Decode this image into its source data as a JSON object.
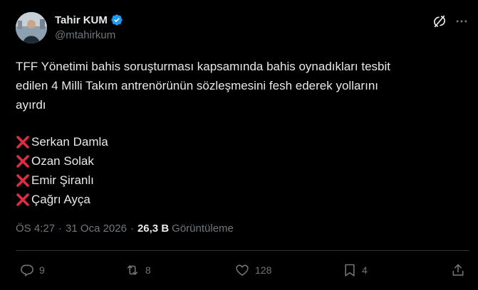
{
  "author": {
    "display_name": "Tahir KUM",
    "handle": "@mtahirkum",
    "verified_color": "#1d9bf0"
  },
  "header_icons": {
    "grok": "grok-icon",
    "more": "more-icon"
  },
  "tweet": {
    "lines": [
      "TFF Yönetimi bahis soruşturması kapsamında bahis oynadıkları tesbit",
      "edilen 4 Milli Takım antrenörünün sözleşmesini fesh ederek yollarını",
      "ayırdı"
    ],
    "list": [
      "Serkan Damla",
      "Ozan Solak",
      "Emir Şiranlı",
      "Çağrı Ayça"
    ],
    "list_icon": "red-cross-mark-icon",
    "list_icon_color": "#dd2e44"
  },
  "meta": {
    "time": "ÖS 4:27",
    "separator": "·",
    "date": "31 Oca 2026",
    "views_count": "26,3 B",
    "views_label": "Görüntüleme"
  },
  "actions": {
    "reply_count": "9",
    "retweet_count": "8",
    "like_count": "128",
    "bookmark_count": "4"
  },
  "colors": {
    "background": "#000000",
    "text": "#e7e9ea",
    "muted": "#71767b",
    "divider": "#2f3336"
  }
}
